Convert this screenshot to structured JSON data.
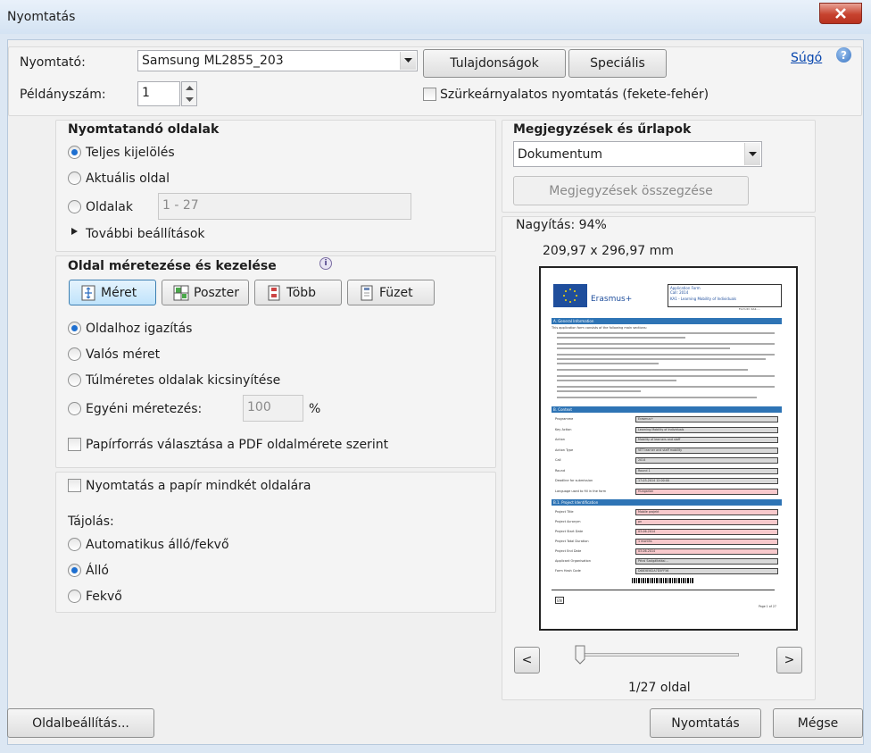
{
  "window": {
    "title": "Nyomtatás"
  },
  "top": {
    "printer_label": "Nyomtató:",
    "printer_value": "Samsung ML2855_203",
    "properties_button": "Tulajdonságok",
    "advanced_button": "Speciális",
    "help_link": "Súgó",
    "copies_label": "Példányszám:",
    "copies_value": "1",
    "grayscale_label": "Szürkeárnyalatos nyomtatás (fekete-fehér)"
  },
  "pages": {
    "title": "Nyomtatandó oldalak",
    "options": [
      "Teljes kijelölés",
      "Aktuális oldal",
      "Oldalak"
    ],
    "selected": 0,
    "range_placeholder": "1 - 27",
    "more": "További beállítások"
  },
  "sizing": {
    "title": "Oldal méretezése és kezelése",
    "tools": [
      "Méret",
      "Poszter",
      "Több",
      "Füzet"
    ],
    "selected_tool": 0,
    "options": [
      "Oldalhoz igazítás",
      "Valós méret",
      "Túlméretes oldalak kicsinyítése",
      "Egyéni méretezés:"
    ],
    "selected": 0,
    "custom_value": "100",
    "percent": "%",
    "paper_source": "Papírforrás választása a PDF oldalmérete szerint"
  },
  "duplex": {
    "label": "Nyomtatás a papír mindkét oldalára",
    "orientation_title": "Tájolás:",
    "orientations": [
      "Automatikus álló/fekvő",
      "Álló",
      "Fekvő"
    ],
    "selected": 1
  },
  "comments": {
    "title": "Megjegyzések és űrlapok",
    "value": "Dokumentum",
    "summary_button": "Megjegyzések összegzése"
  },
  "preview": {
    "zoom_label": "Nagyítás:",
    "zoom_value": "94%",
    "dimensions": "209,97 x 296,97 mm",
    "page_indicator": "1/27 oldal",
    "prev": "<",
    "next": ">",
    "page_progress": 0.0,
    "doc": {
      "logo": "Erasmus+",
      "header": [
        "Application Form",
        "Call: 2014",
        "KA1 - Learning Mobility of Individuals"
      ],
      "form_id": "Form ID: KA1-…",
      "sections": [
        "A. General Information",
        "B. Context",
        "B.1. Project Identification"
      ],
      "general_text": "This application form consists of the following main sections:",
      "context": [
        [
          "Programme",
          "Erasmus+",
          "g"
        ],
        [
          "Key Action",
          "Learning Mobility of Individuals",
          "g"
        ],
        [
          "Action",
          "Mobility of learners and staff",
          "g"
        ],
        [
          "Action Type",
          "VET learner and staff mobility",
          "g"
        ],
        [
          "Call",
          "2014",
          "g"
        ],
        [
          "Round",
          "Round 1",
          "g"
        ],
        [
          "Deadline for submission",
          "17-03-2014 12:00:00",
          "g"
        ],
        [
          "Language used to fill in the form",
          "Hungarian",
          "p"
        ]
      ],
      "identification": [
        [
          "Project Title",
          "Mobile projekt",
          "p"
        ],
        [
          "Project Acronym",
          "pn",
          "p"
        ],
        [
          "Project Start Date",
          "03-06-2014",
          "p"
        ],
        [
          "Project Total Duration",
          "1 months",
          "p"
        ],
        [
          "Project End Date",
          "03-06-2014",
          "p"
        ],
        [
          "Applicant Organisation",
          "Pécsi Szolgáltatási…",
          "g"
        ],
        [
          "Form Hash Code",
          "D6B38582A7D5FF56",
          "g"
        ]
      ],
      "footer_lang": "EN",
      "footer_page": "Page 1 of 27"
    }
  },
  "bottom": {
    "page_setup": "Oldalbeállítás...",
    "print": "Nyomtatás",
    "cancel": "Mégse"
  },
  "colors": {
    "accent": "#1e6fd0",
    "link": "#0645ad",
    "doc_blue": "#2e74b5",
    "close": "#c7432f"
  }
}
